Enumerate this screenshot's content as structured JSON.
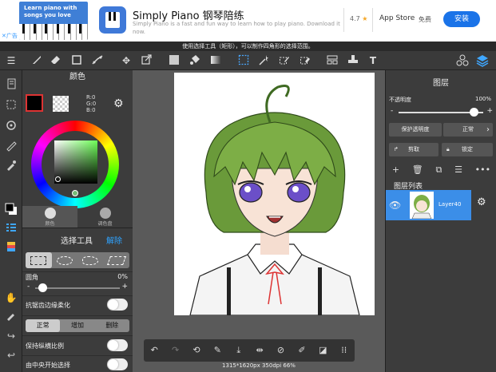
{
  "ad": {
    "banner_text": "Learn piano with songs you love",
    "ad_label": "✕广告",
    "title": "Simply Piano 钢琴陪练",
    "description": "Simply Piano is a fast and fun way to learn how to play piano. Download it now.",
    "rating": "4.7",
    "star": "★",
    "store": "App Store",
    "price": "免费",
    "install": "安装"
  },
  "hint": "使用选择工具（矩形），可以制作四角形的选择范围。",
  "toolbar": {
    "text_tool": "T"
  },
  "color_panel": {
    "title": "颜色",
    "r": "R:0",
    "g": "G:0",
    "b": "B:0",
    "tab_color": "颜色",
    "tab_palette": "调色盘",
    "primary": "#000000",
    "secondary": "#ffffff",
    "hue": "#6dff57"
  },
  "selection_panel": {
    "title": "选择工具",
    "reset": "解除",
    "corner_label": "圆角",
    "corner_value": "0%",
    "antialias_label": "抗锯齿边缘柔化",
    "modes": [
      "正常",
      "增加",
      "删除"
    ],
    "keep_ratio_label": "保持纵横比例",
    "from_center_label": "由中央开始选择"
  },
  "canvas": {
    "status": "1315*1620px 350dpi 66%"
  },
  "layer_panel": {
    "title": "图层",
    "opacity_label": "不透明度",
    "opacity_value": "100%",
    "protect_alpha": "保护透明度",
    "blend_mode": "正常",
    "clip": "剪取",
    "lock": "锁定",
    "list_title": "图层列表",
    "layer_name": "Layer40"
  }
}
